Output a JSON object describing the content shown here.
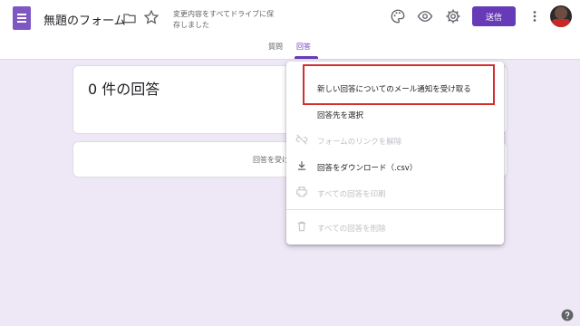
{
  "header": {
    "title": "無題のフォーム",
    "save_status": "変更内容をすべてドライブに保存しました",
    "send_label": "送信"
  },
  "tabs": [
    {
      "label": "質問",
      "active": false
    },
    {
      "label": "回答",
      "active": true
    }
  ],
  "responses": {
    "count_label": "0 件の回答",
    "accepting_label": "回答を受け"
  },
  "menu": {
    "items": [
      {
        "label": "新しい回答についてのメール通知を受け取る",
        "icon": "none",
        "disabled": false,
        "highlighted": true
      },
      {
        "label": "回答先を選択",
        "icon": "none",
        "disabled": false
      },
      {
        "label": "フォームのリンクを解除",
        "icon": "unlink-icon",
        "disabled": true
      },
      {
        "label": "回答をダウンロード（.csv）",
        "icon": "download-icon",
        "disabled": false
      },
      {
        "label": "すべての回答を印刷",
        "icon": "print-icon",
        "disabled": true
      },
      {
        "label": "すべての回答を削除",
        "icon": "trash-icon",
        "disabled": true
      }
    ]
  },
  "colors": {
    "accent": "#673ab7",
    "highlight_box": "#d32f2f",
    "background": "#ede7f6"
  }
}
